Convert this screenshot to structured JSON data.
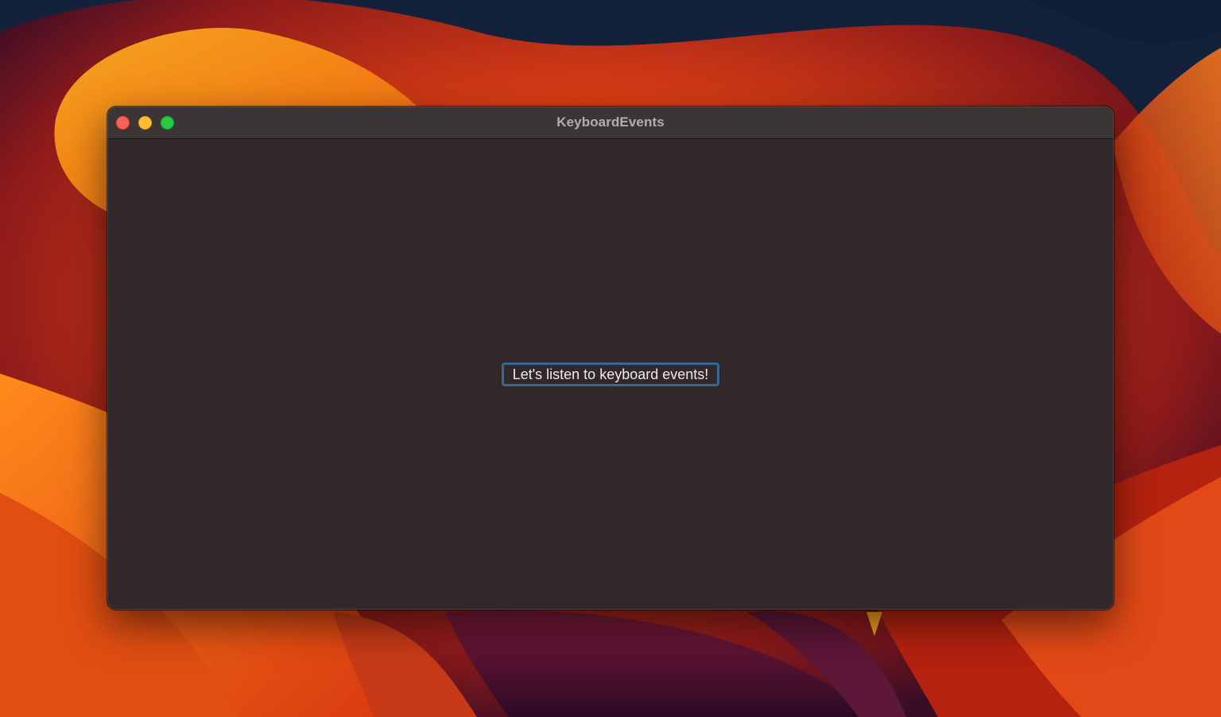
{
  "window": {
    "title": "KeyboardEvents"
  },
  "content": {
    "label": "Let's listen to keyboard events!"
  },
  "colors": {
    "close": "#fe5f57",
    "minimize": "#febc2e",
    "zoom": "#28c840",
    "focus_ring": "#356896",
    "window_background": "#322829"
  },
  "icons": {
    "close": "close-circle-icon",
    "minimize": "minimize-circle-icon",
    "zoom": "zoom-circle-icon"
  }
}
